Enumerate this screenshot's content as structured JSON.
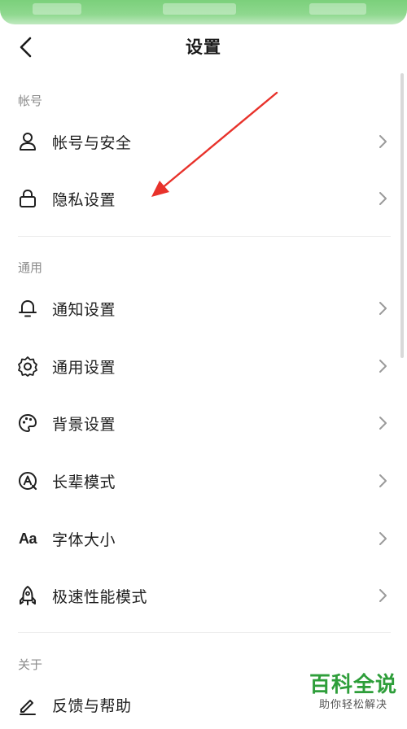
{
  "header": {
    "title": "设置"
  },
  "sections": {
    "account": {
      "title": "帐号",
      "items": [
        {
          "label": "帐号与安全",
          "icon": "person-icon"
        },
        {
          "label": "隐私设置",
          "icon": "lock-icon"
        }
      ]
    },
    "general": {
      "title": "通用",
      "items": [
        {
          "label": "通知设置",
          "icon": "bell-icon"
        },
        {
          "label": "通用设置",
          "icon": "gear-icon"
        },
        {
          "label": "背景设置",
          "icon": "palette-icon"
        },
        {
          "label": "长辈模式",
          "icon": "elder-mode-icon"
        },
        {
          "label": "字体大小",
          "icon": "font-size-icon",
          "glyph": "Aa"
        },
        {
          "label": "极速性能模式",
          "icon": "rocket-icon"
        }
      ]
    },
    "about": {
      "title": "关于",
      "items": [
        {
          "label": "反馈与帮助",
          "icon": "pencil-icon"
        }
      ]
    }
  },
  "watermark": {
    "main": "百科全说",
    "sub": "助你轻松解决"
  },
  "colors": {
    "top_strip": "#8fd88f",
    "annotation_arrow": "#e8322b",
    "watermark_green": "#2e9e3a",
    "section_header": "#8c8c8c",
    "chevron": "#9a9a9a"
  }
}
